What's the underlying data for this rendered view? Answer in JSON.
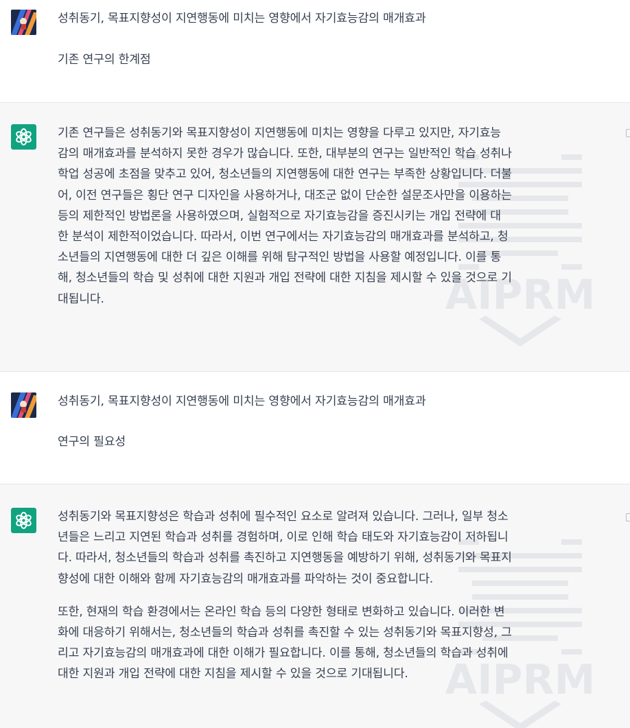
{
  "conversation": {
    "messages": [
      {
        "role": "user",
        "lines": [
          "성취동기, 목표지향성이 지연행동에 미치는 영향에서 자기효능감의 매개효과",
          "기존 연구의 한계점"
        ]
      },
      {
        "role": "assistant",
        "paragraphs": [
          [
            "기존 연구들은 성취동기와 목표지향성이 지연행동에 미치는 영향을 다루고 있지만, 자기효능",
            "감의 매개효과를 분석하지 못한 경우가 많습니다. 또한, 대부분의 연구는 일반적인 학습 성취나",
            "학업 성공에 초점을 맞추고 있어, 청소년들의 지연행동에 대한 연구는 부족한 상황입니다. 더불",
            "어, 이전 연구들은 횡단 연구 디자인을 사용하거나, 대조군 없이 단순한 설문조사만을 이용하는",
            "등의 제한적인 방법론을 사용하였으며, 실험적으로 자기효능감을 증진시키는 개입 전략에 대",
            "한 분석이 제한적이었습니다. 따라서, 이번 연구에서는 자기효능감의 매개효과를 분석하고, 청",
            "소년들의 지연행동에 대한 더 깊은 이해를 위해 탐구적인 방법을 사용할 예정입니다. 이를 통",
            "해, 청소년들의 학습 및 성취에 대한 지원과 개입 전략에 대한 지침을 제시할 수 있을 것으로 기",
            "대됩니다."
          ]
        ]
      },
      {
        "role": "user",
        "lines": [
          "성취동기, 목표지향성이 지연행동에 미치는 영향에서 자기효능감의 매개효과",
          "연구의 필요성"
        ]
      },
      {
        "role": "assistant",
        "paragraphs": [
          [
            "성취동기와 목표지향성은 학습과 성취에 필수적인 요소로 알려져 있습니다. 그러나, 일부 청소",
            "년들은 느리고 지연된 학습과 성취를 경험하며, 이로 인해 학습 태도와 자기효능감이 저하됩니",
            "다. 따라서, 청소년들의 학습과 성취를 촉진하고 지연행동을 예방하기 위해, 성취동기와 목표지",
            "향성에 대한 이해와 함께 자기효능감의 매개효과를 파악하는 것이 중요합니다."
          ],
          [
            "또한, 현재의 학습 환경에서는 온라인 학습 등의 다양한 형태로 변화하고 있습니다. 이러한 변",
            "화에 대응하기 위해서는, 청소년들의 학습과 성취를 촉진할 수 있는 성취동기와 목표지향성, 그",
            "리고 자기효능감의 매개효과에 대한 이해가 필요합니다. 이를 통해, 청소년들의 학습과 성취에",
            "대한 지원과 개입 전략에 대한 지침을 제시할 수 있을 것으로 기대됩니다."
          ]
        ]
      }
    ]
  },
  "icons": {
    "user_avatar": "user-avatar-icon",
    "assistant_avatar": "openai-logo-icon",
    "copy": "copy-icon"
  },
  "colors": {
    "assistant_bg": "#f7f7f8",
    "openai_green": "#10a37f",
    "text": "#374151"
  }
}
